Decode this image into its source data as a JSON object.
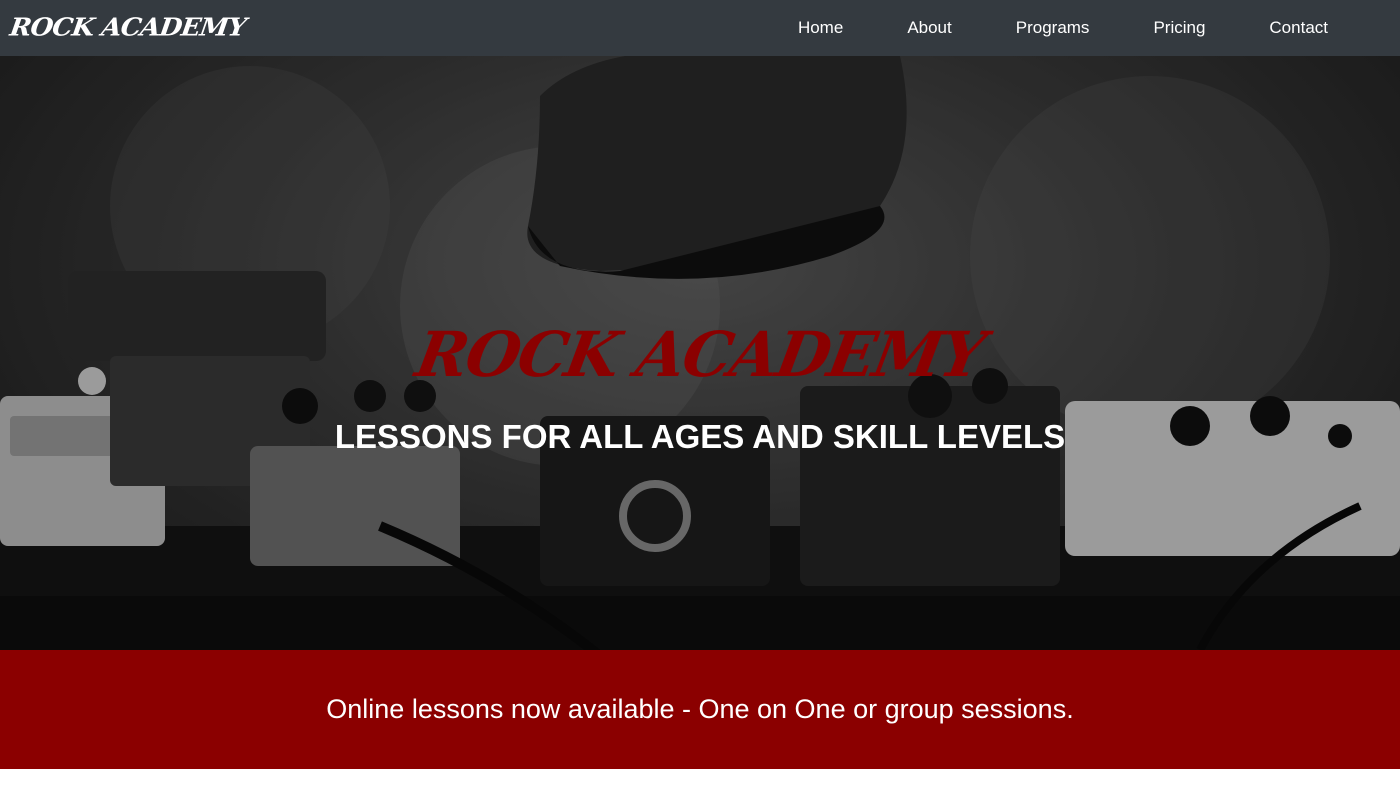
{
  "brand": {
    "name": "Rock Academy"
  },
  "nav": {
    "items": [
      {
        "label": "Home"
      },
      {
        "label": "About"
      },
      {
        "label": "Programs"
      },
      {
        "label": "Pricing"
      },
      {
        "label": "Contact"
      }
    ]
  },
  "hero": {
    "title": "Rock Academy",
    "subtitle": "Lessons for all ages and skill levels"
  },
  "banner": {
    "text": "Online lessons now available - One on One or group sessions."
  },
  "colors": {
    "navbar": "#343a40",
    "accent": "#8b0000",
    "text_light": "#ffffff"
  }
}
